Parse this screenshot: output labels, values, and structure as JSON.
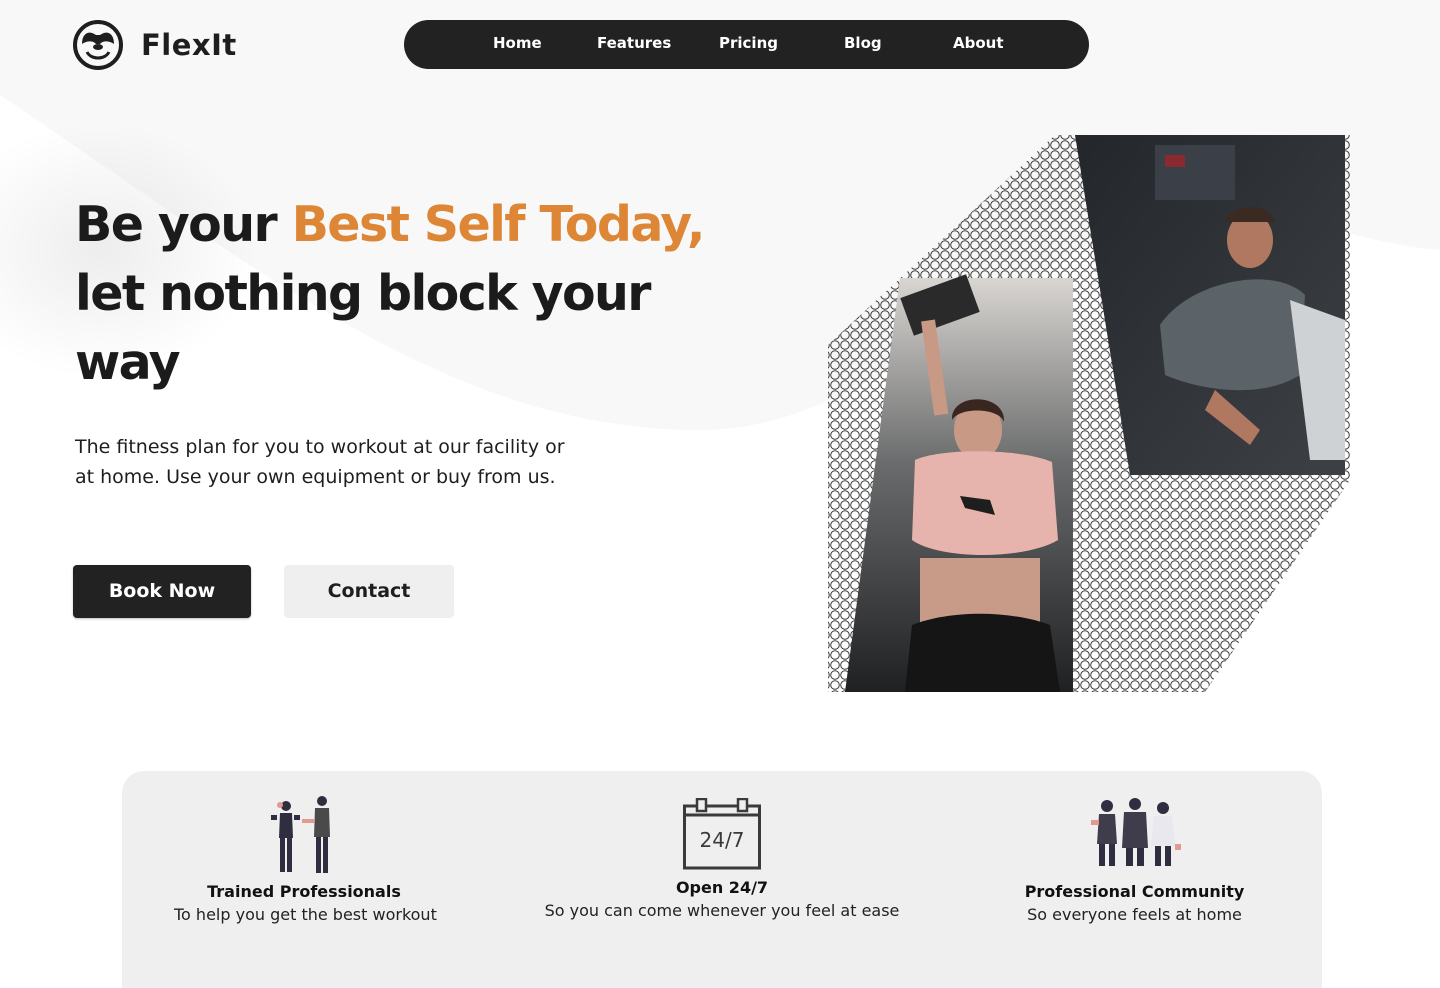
{
  "brand": {
    "name": "FlexIt",
    "logo_icon": "panda-face-icon"
  },
  "nav": {
    "items": [
      "Home",
      "Features",
      "Pricing",
      "Blog",
      "About"
    ]
  },
  "hero": {
    "headline_part1": "Be your ",
    "headline_accent": "Best Self Today,",
    "headline_part2": "let nothing block your way",
    "subtext": "The fitness plan for you to workout at our facility or at home. Use your own equipment or buy from us.",
    "primary_button": "Book Now",
    "secondary_button": "Contact",
    "photos": [
      "woman-lifting-dumbbell-photo",
      "man-leg-press-photo"
    ]
  },
  "features": [
    {
      "icon": "trainers-illustration-icon",
      "title": "Trained Professionals",
      "description": "To help you get the best workout"
    },
    {
      "icon": "calendar-icon",
      "icon_text": "24/7",
      "title": "Open 24/7",
      "description": "So you can come whenever you feel at ease"
    },
    {
      "icon": "community-people-icon",
      "title": "Professional Community",
      "description": "So everyone feels at home"
    }
  ],
  "colors": {
    "dark": "#222222",
    "accent": "#dd8636",
    "panel": "#efefef"
  }
}
